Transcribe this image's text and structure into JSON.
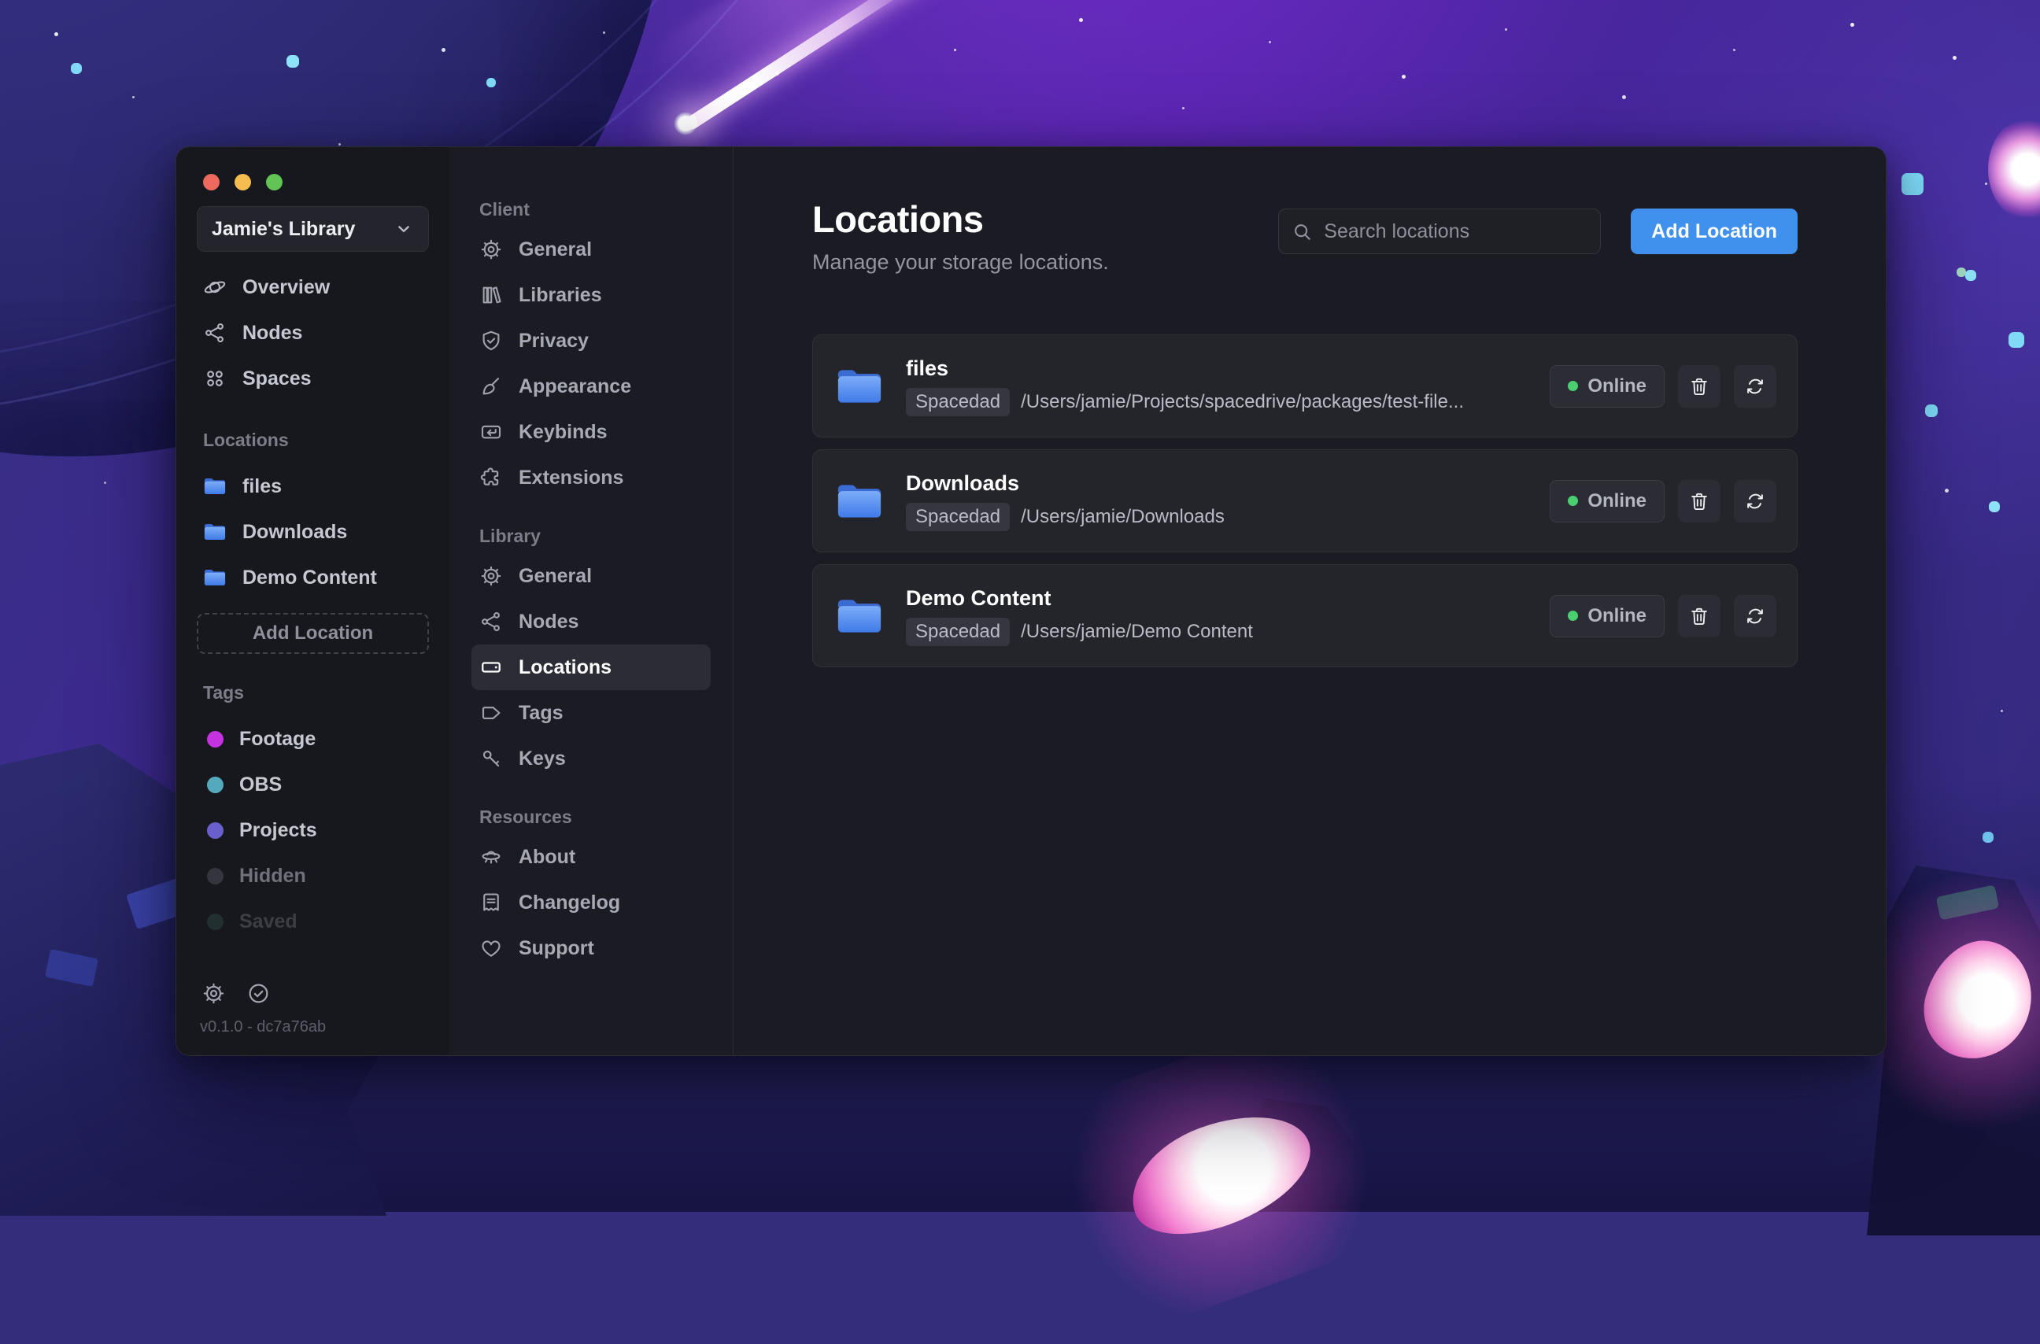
{
  "window_controls": {
    "buttons": [
      "close",
      "minimize",
      "zoom"
    ]
  },
  "sidebar": {
    "library_label": "Jamie's Library",
    "nav": [
      {
        "label": "Overview",
        "icon": "planet"
      },
      {
        "label": "Nodes",
        "icon": "share-network"
      },
      {
        "label": "Spaces",
        "icon": "squares-four"
      }
    ],
    "locations_heading": "Locations",
    "locations": [
      {
        "label": "files",
        "icon": "folder"
      },
      {
        "label": "Downloads",
        "icon": "folder"
      },
      {
        "label": "Demo Content",
        "icon": "folder"
      }
    ],
    "add_location_label": "Add Location",
    "tags_heading": "Tags",
    "tags": [
      {
        "label": "Footage",
        "color": "#c433e0"
      },
      {
        "label": "OBS",
        "color": "#55a9bd"
      },
      {
        "label": "Projects",
        "color": "#6a60cd"
      },
      {
        "label": "Hidden",
        "color": "#34353d"
      },
      {
        "label": "Saved",
        "color": "#2f4f45"
      }
    ],
    "footer": {
      "version": "v0.1.0 - dc7a76ab",
      "icons": [
        "gear",
        "check-circle"
      ]
    }
  },
  "settings_nav": {
    "sections": [
      {
        "heading": "Client",
        "items": [
          {
            "label": "General",
            "icon": "gear"
          },
          {
            "label": "Libraries",
            "icon": "books"
          },
          {
            "label": "Privacy",
            "icon": "shield-check"
          },
          {
            "label": "Appearance",
            "icon": "paint-brush"
          },
          {
            "label": "Keybinds",
            "icon": "key-return"
          },
          {
            "label": "Extensions",
            "icon": "puzzle-piece"
          }
        ]
      },
      {
        "heading": "Library",
        "items": [
          {
            "label": "General",
            "icon": "gear"
          },
          {
            "label": "Nodes",
            "icon": "share-network"
          },
          {
            "label": "Locations",
            "icon": "drive",
            "active": true
          },
          {
            "label": "Tags",
            "icon": "tag"
          },
          {
            "label": "Keys",
            "icon": "key"
          }
        ]
      },
      {
        "heading": "Resources",
        "items": [
          {
            "label": "About",
            "icon": "flying-saucer"
          },
          {
            "label": "Changelog",
            "icon": "note"
          },
          {
            "label": "Support",
            "icon": "heart"
          }
        ]
      }
    ]
  },
  "main": {
    "title": "Locations",
    "subtitle": "Manage your storage locations.",
    "search": {
      "placeholder": "Search locations",
      "icon": "magnifying-glass"
    },
    "add_button_label": "Add Location",
    "locations": [
      {
        "name": "files",
        "node_badge": "Spacedad",
        "path": "/Users/jamie/Projects/spacedrive/packages/test-file...",
        "status": "Online",
        "action_icons": [
          "trash-icon",
          "rescan-icon"
        ]
      },
      {
        "name": "Downloads",
        "node_badge": "Spacedad",
        "path": "/Users/jamie/Downloads",
        "status": "Online",
        "action_icons": [
          "trash-icon",
          "rescan-icon"
        ]
      },
      {
        "name": "Demo Content",
        "node_badge": "Spacedad",
        "path": "/Users/jamie/Demo Content",
        "status": "Online",
        "action_icons": [
          "trash-icon",
          "rescan-icon"
        ]
      }
    ]
  },
  "colors": {
    "accent_blue": "#4090ee",
    "online_green": "#4ace6f",
    "folder_blue": "#4b84ec"
  }
}
